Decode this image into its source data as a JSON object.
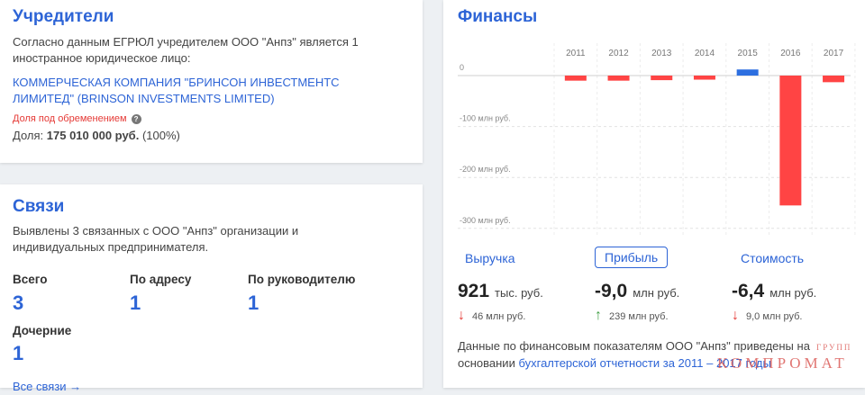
{
  "founders": {
    "title": "Учредители",
    "description": "Согласно данным ЕГРЮЛ учредителем ООО \"Анпз\" является 1 иностранное юридическое лицо:",
    "company_line1": "КОММЕРЧЕСКАЯ КОМПАНИЯ \"БРИНСОН ИНВЕСТМЕНТС",
    "company_line2": "ЛИМИТЕД\" (BRINSON INVESTMENTS LIMITED)",
    "encumbrance": "Доля под обременением",
    "share_label": "Доля:",
    "share_value": "175 010 000 руб.",
    "share_percent": "(100%)"
  },
  "links": {
    "title": "Связи",
    "description": "Выявлены 3 связанных с ООО \"Анпз\" организации и индивидуальных предпринимателя.",
    "stats": [
      {
        "label": "Всего",
        "value": "3"
      },
      {
        "label": "По адресу",
        "value": "1"
      },
      {
        "label": "По руководителю",
        "value": "1"
      },
      {
        "label": "Дочерние",
        "value": "1"
      }
    ],
    "all_links": "Все связи →"
  },
  "finance": {
    "title": "Финансы",
    "tabs": [
      "Выручка",
      "Прибыль",
      "Стоимость"
    ],
    "active_tab": "Прибыль",
    "metrics": [
      {
        "value": "921",
        "unit": "тыс. руб.",
        "delta": "46 млн руб.",
        "direction": "down"
      },
      {
        "value": "-9,0",
        "unit": "млн руб.",
        "delta": "239 млн руб.",
        "direction": "up"
      },
      {
        "value": "-6,4",
        "unit": "млн руб.",
        "delta": "9,0 млн руб.",
        "direction": "down"
      }
    ],
    "note_before": "Данные по финансовым показателям ООО \"Анпз\" приведены на основании ",
    "note_link": "бухгалтерской отчетности за 2011 – 2017 годы",
    "colors": {
      "negative": "#ff4444",
      "positive": "#2d6fe0"
    }
  },
  "chart_data": {
    "type": "bar",
    "categories": [
      "2011",
      "2012",
      "2013",
      "2014",
      "2015",
      "2016",
      "2017"
    ],
    "values": [
      -10,
      -10,
      -9,
      -8,
      12,
      -255,
      -13
    ],
    "ylim": [
      -300,
      10
    ],
    "yticks": [
      0,
      -100,
      -200,
      -300
    ],
    "ytick_labels": [
      "0",
      "-100 млн руб.",
      "-200 млн руб.",
      "-300 млн руб."
    ],
    "grid": true
  },
  "watermark": {
    "main": "КОМПРОМАТ",
    "small": "ГРУПП"
  }
}
